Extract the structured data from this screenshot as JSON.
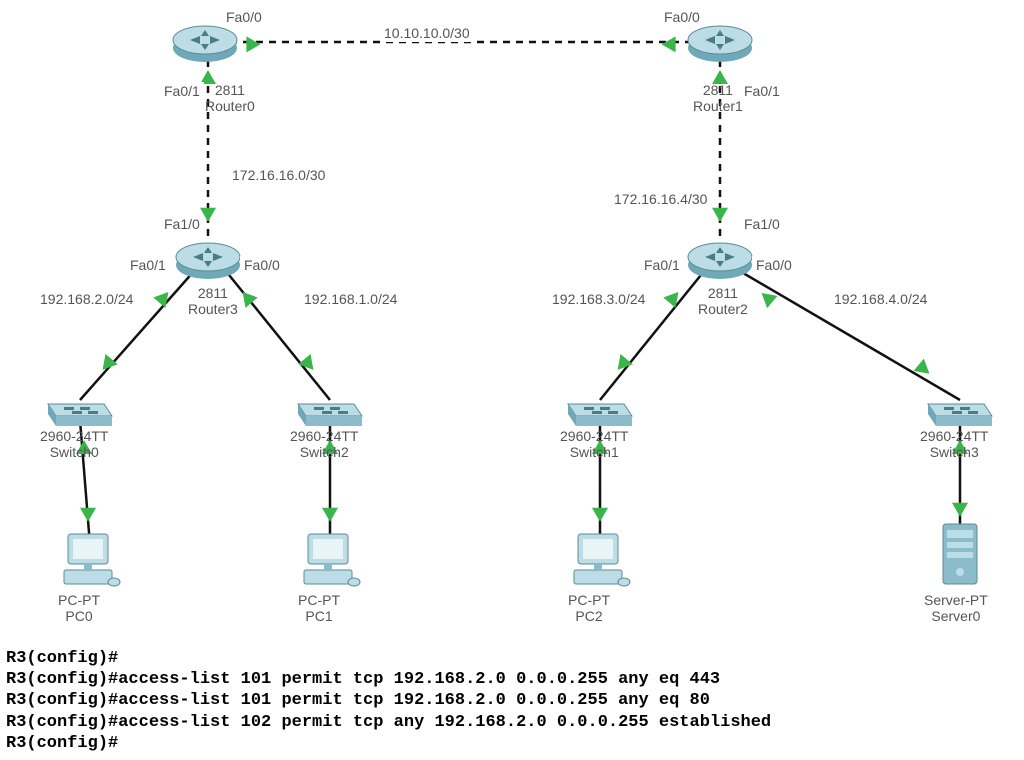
{
  "link_subnet_top": "10.10.10.0/30",
  "r0": {
    "model": "2811",
    "name": "Router0",
    "if_top": "Fa0/0",
    "if_down": "Fa0/1"
  },
  "r1": {
    "model": "2811",
    "name": "Router1",
    "if_top": "Fa0/0",
    "if_down": "Fa0/1"
  },
  "r3": {
    "model": "2811",
    "name": "Router3",
    "if_up": "Fa1/0",
    "if_left": "Fa0/1",
    "if_right": "Fa0/0",
    "up_subnet": "172.16.16.0/30",
    "left_subnet": "192.168.2.0/24",
    "right_subnet": "192.168.1.0/24"
  },
  "r2": {
    "model": "2811",
    "name": "Router2",
    "if_up": "Fa1/0",
    "if_left": "Fa0/1",
    "if_right": "Fa0/0",
    "up_subnet": "172.16.16.4/30",
    "left_subnet": "192.168.3.0/24",
    "right_subnet": "192.168.4.0/24"
  },
  "sw0": {
    "model": "2960-24TT",
    "name": "Switch0"
  },
  "sw2": {
    "model": "2960-24TT",
    "name": "Switch2"
  },
  "sw1": {
    "model": "2960-24TT",
    "name": "Switch1"
  },
  "sw3": {
    "model": "2960-24TT",
    "name": "Switch3"
  },
  "pc0": {
    "model": "PC-PT",
    "name": "PC0"
  },
  "pc1": {
    "model": "PC-PT",
    "name": "PC1"
  },
  "pc2": {
    "model": "PC-PT",
    "name": "PC2"
  },
  "srv": {
    "model": "Server-PT",
    "name": "Server0"
  },
  "cli": {
    "l1": "R3(config)#",
    "l2": "R3(config)#access-list 101 permit tcp 192.168.2.0 0.0.0.255 any eq 443",
    "l3": "R3(config)#access-list 101 permit tcp 192.168.2.0 0.0.0.255 any eq 80",
    "l4": "R3(config)#access-list 102 permit tcp any 192.168.2.0 0.0.0.255 established",
    "l5": "R3(config)#"
  }
}
